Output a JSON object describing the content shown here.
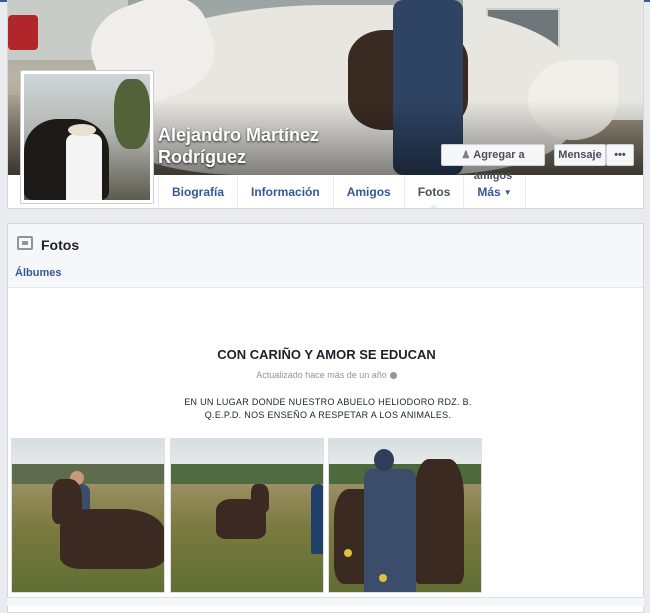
{
  "profile": {
    "name": "Alejandro Martínez Rodríguez",
    "buttons": {
      "add_friend": "Agregar a amigos",
      "message": "Mensaje",
      "more": "•••"
    },
    "tabs": [
      {
        "label": "Biografía"
      },
      {
        "label": "Información"
      },
      {
        "label": "Amigos"
      },
      {
        "label": "Fotos"
      },
      {
        "label": "Más"
      }
    ],
    "active_tab": "Fotos"
  },
  "photos": {
    "section_title": "Fotos",
    "albums_link": "Álbumes",
    "album": {
      "title": "CON CARIÑO Y AMOR SE EDUCAN",
      "updated": "Actualizado hace más de un año",
      "description": "EN UN LUGAR DONDE NUESTRO ABUELO HELIODORO RDZ. B. Q.E.P.D. NOS ENSEÑO A RESPETAR A LOS ANIMALES."
    }
  },
  "icons": {
    "add_friend": "add-friend-icon",
    "more": "more-icon",
    "caret": "caret-down-icon",
    "photos": "photos-icon",
    "privacy": "globe-icon"
  },
  "colors": {
    "link": "#365899",
    "brand": "#3b5998",
    "page_bg": "#e9ebee"
  }
}
